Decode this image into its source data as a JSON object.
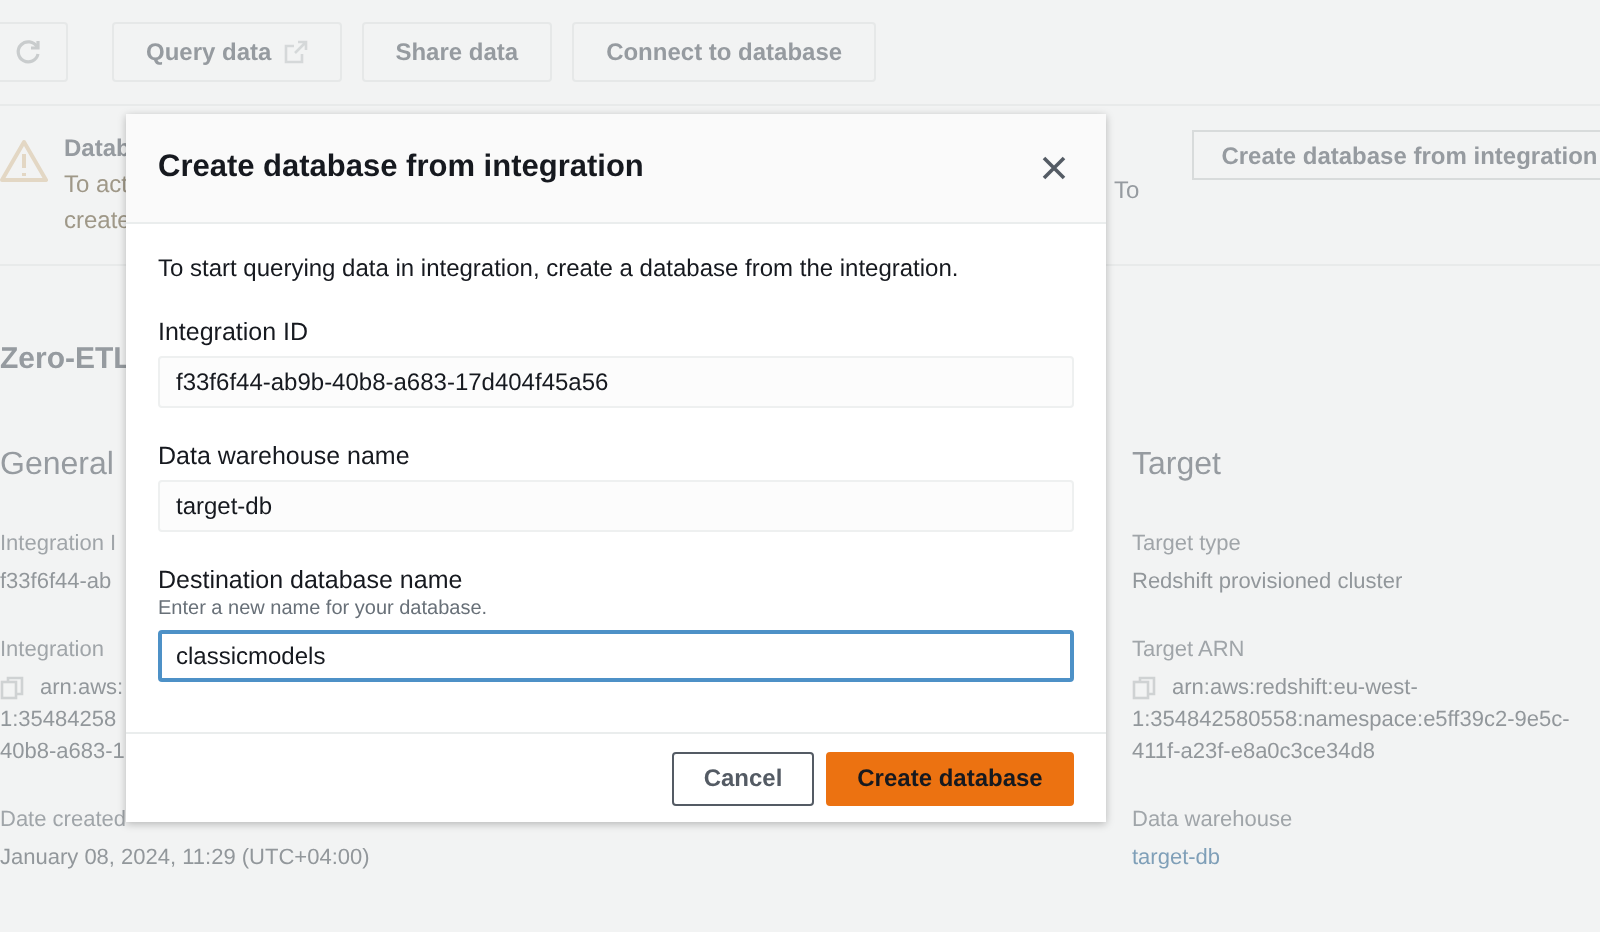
{
  "toolbar": {
    "buttons": [
      {
        "label": "Query data",
        "external": true
      },
      {
        "label": "Share data",
        "external": false
      },
      {
        "label": "Connect to database",
        "external": false
      }
    ]
  },
  "alert": {
    "title": "Datab",
    "lines": [
      "To act",
      "create"
    ],
    "tail": "To",
    "action": "Create database from integration"
  },
  "page_title": "Zero-ETL",
  "sections": [
    {
      "title": "General",
      "fields": [
        {
          "kind": "text",
          "label": "Integration I",
          "lines": [
            "f33f6f44-ab"
          ]
        },
        {
          "kind": "copy",
          "label": "Integration",
          "lines": [
            "arn:aws:",
            "1:35484258",
            "40b8-a683-1"
          ]
        },
        {
          "kind": "text",
          "label": "Date created",
          "lines": [
            "January 08, 2024, 11:29 (UTC+04:00)"
          ]
        }
      ]
    },
    {
      "title": "Target",
      "fields": [
        {
          "kind": "text",
          "label": "Target type",
          "lines": [
            "Redshift provisioned cluster"
          ]
        },
        {
          "kind": "copy",
          "label": "Target ARN",
          "lines": [
            "arn:aws:redshift:eu-west-",
            "1:354842580558:namespace:e5ff39c2-9e5c-",
            "411f-a23f-e8a0c3ce34d8"
          ]
        },
        {
          "kind": "link",
          "label": "Data warehouse",
          "lines": [
            "target-db"
          ]
        }
      ]
    }
  ],
  "modal": {
    "title": "Create database from integration",
    "description": "To start querying data in integration, create a database from the integration.",
    "fields": [
      {
        "label": "Integration ID",
        "value": "f33f6f44-ab9b-40b8-a683-17d404f45a56",
        "disabled": true,
        "focused": false
      },
      {
        "label": "Data warehouse name",
        "value": "target-db",
        "disabled": true,
        "focused": false
      },
      {
        "label": "Destination database name",
        "hint": "Enter a new name for your database.",
        "value": "classicmodels",
        "disabled": false,
        "focused": true
      }
    ],
    "buttons": [
      {
        "label": "Cancel",
        "kind": "secondary"
      },
      {
        "label": "Create database",
        "kind": "primary"
      }
    ]
  }
}
